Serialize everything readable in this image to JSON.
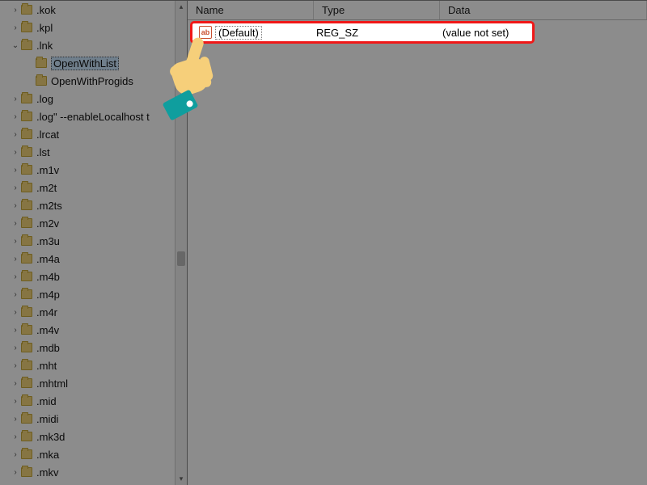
{
  "tree": {
    "base_indent": 12,
    "step_indent": 18,
    "items": [
      {
        "label": ".kok",
        "level": 1,
        "expander": "right"
      },
      {
        "label": ".kpl",
        "level": 1,
        "expander": "right"
      },
      {
        "label": ".lnk",
        "level": 1,
        "expander": "down",
        "expanded": true
      },
      {
        "label": "OpenWithList",
        "level": 2,
        "expander": "none",
        "selected": true
      },
      {
        "label": "OpenWithProgids",
        "level": 2,
        "expander": "none"
      },
      {
        "label": ".log",
        "level": 1,
        "expander": "right"
      },
      {
        "label": ".log\" --enableLocalhost t",
        "level": 1,
        "expander": "right"
      },
      {
        "label": ".lrcat",
        "level": 1,
        "expander": "right"
      },
      {
        "label": ".lst",
        "level": 1,
        "expander": "right"
      },
      {
        "label": ".m1v",
        "level": 1,
        "expander": "right"
      },
      {
        "label": ".m2t",
        "level": 1,
        "expander": "right"
      },
      {
        "label": ".m2ts",
        "level": 1,
        "expander": "right"
      },
      {
        "label": ".m2v",
        "level": 1,
        "expander": "right"
      },
      {
        "label": ".m3u",
        "level": 1,
        "expander": "right"
      },
      {
        "label": ".m4a",
        "level": 1,
        "expander": "right"
      },
      {
        "label": ".m4b",
        "level": 1,
        "expander": "right"
      },
      {
        "label": ".m4p",
        "level": 1,
        "expander": "right"
      },
      {
        "label": ".m4r",
        "level": 1,
        "expander": "right"
      },
      {
        "label": ".m4v",
        "level": 1,
        "expander": "right"
      },
      {
        "label": ".mdb",
        "level": 1,
        "expander": "right"
      },
      {
        "label": ".mht",
        "level": 1,
        "expander": "right"
      },
      {
        "label": ".mhtml",
        "level": 1,
        "expander": "right"
      },
      {
        "label": ".mid",
        "level": 1,
        "expander": "right"
      },
      {
        "label": ".midi",
        "level": 1,
        "expander": "right"
      },
      {
        "label": ".mk3d",
        "level": 1,
        "expander": "right"
      },
      {
        "label": ".mka",
        "level": 1,
        "expander": "right"
      },
      {
        "label": ".mkv",
        "level": 1,
        "expander": "right"
      }
    ]
  },
  "columns": {
    "name": "Name",
    "type": "Type",
    "data": "Data"
  },
  "values": [
    {
      "icon_text": "ab",
      "name": "(Default)",
      "type": "REG_SZ",
      "data": "(value not set)"
    }
  ],
  "scrollbar": {
    "up_glyph": "▴",
    "down_glyph": "▾"
  }
}
